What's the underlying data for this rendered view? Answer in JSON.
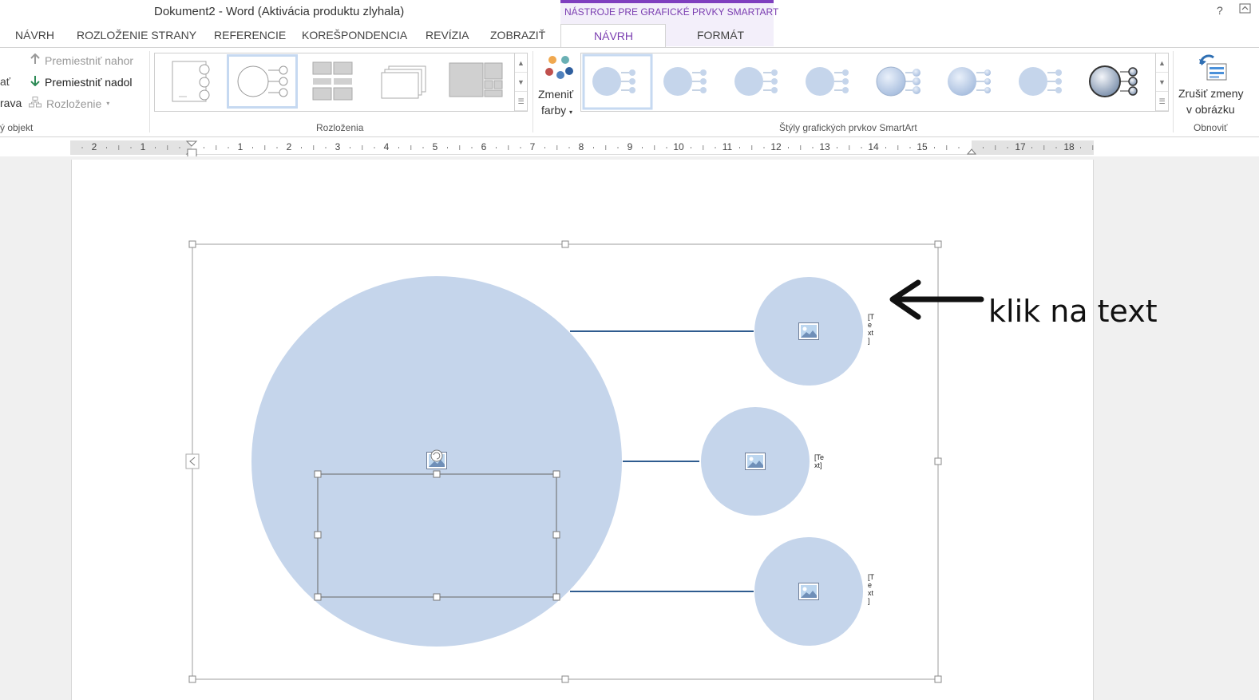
{
  "window": {
    "title": "Dokument2 - Word (Aktivácia produktu zlyhala)",
    "contextual_group_label": "NÁSTROJE PRE GRAFICKÉ PRVKY SMARTART",
    "help_label": "?"
  },
  "tabs": [
    {
      "label": "NÁVRH"
    },
    {
      "label": "ROZLOŽENIE STRANY"
    },
    {
      "label": "REFERENCIE"
    },
    {
      "label": "KOREŠPONDENCIA"
    },
    {
      "label": "REVÍZIA"
    },
    {
      "label": "ZOBRAZIŤ"
    },
    {
      "label": "NÁVRH",
      "active": true
    },
    {
      "label": "FORMÁT"
    }
  ],
  "ribbon": {
    "create_graphic": {
      "items": [
        "ať",
        "rava"
      ],
      "group_label": "ý objekt",
      "move_up": "Premiestniť nahor",
      "move_down": "Premiestniť nadol",
      "layout": "Rozloženie"
    },
    "layouts": {
      "group_label": "Rozloženia"
    },
    "styles": {
      "change_colors": "Zmeniť",
      "change_colors_2": "farby",
      "group_label": "Štýly grafických prvkov SmartArt"
    },
    "reset": {
      "reset_graphic_1": "Zrušiť zmeny",
      "reset_graphic_2": "v obrázku",
      "group_label": "Obnoviť"
    },
    "colors": {
      "accent": "#7a3db0",
      "arrow_up": "#9a9a9a",
      "arrow_down": "#2e8b57"
    }
  },
  "ruler": {
    "numbers": [
      "2",
      "1",
      "1",
      "2",
      "3",
      "4",
      "5",
      "6",
      "7",
      "8",
      "9",
      "10",
      "11",
      "12",
      "13",
      "14",
      "15",
      "17",
      "18"
    ]
  },
  "document": {
    "placeholder_text_1": [
      "[T",
      "e",
      "xt",
      "]"
    ],
    "placeholder_text_2": [
      "[Te",
      "xt]"
    ],
    "placeholder_text_3": [
      "[T",
      "e",
      "xt",
      "]"
    ],
    "annotation": "klik na text",
    "shape_fill": "#c5d5eb",
    "line_color": "#2f5c8f"
  }
}
